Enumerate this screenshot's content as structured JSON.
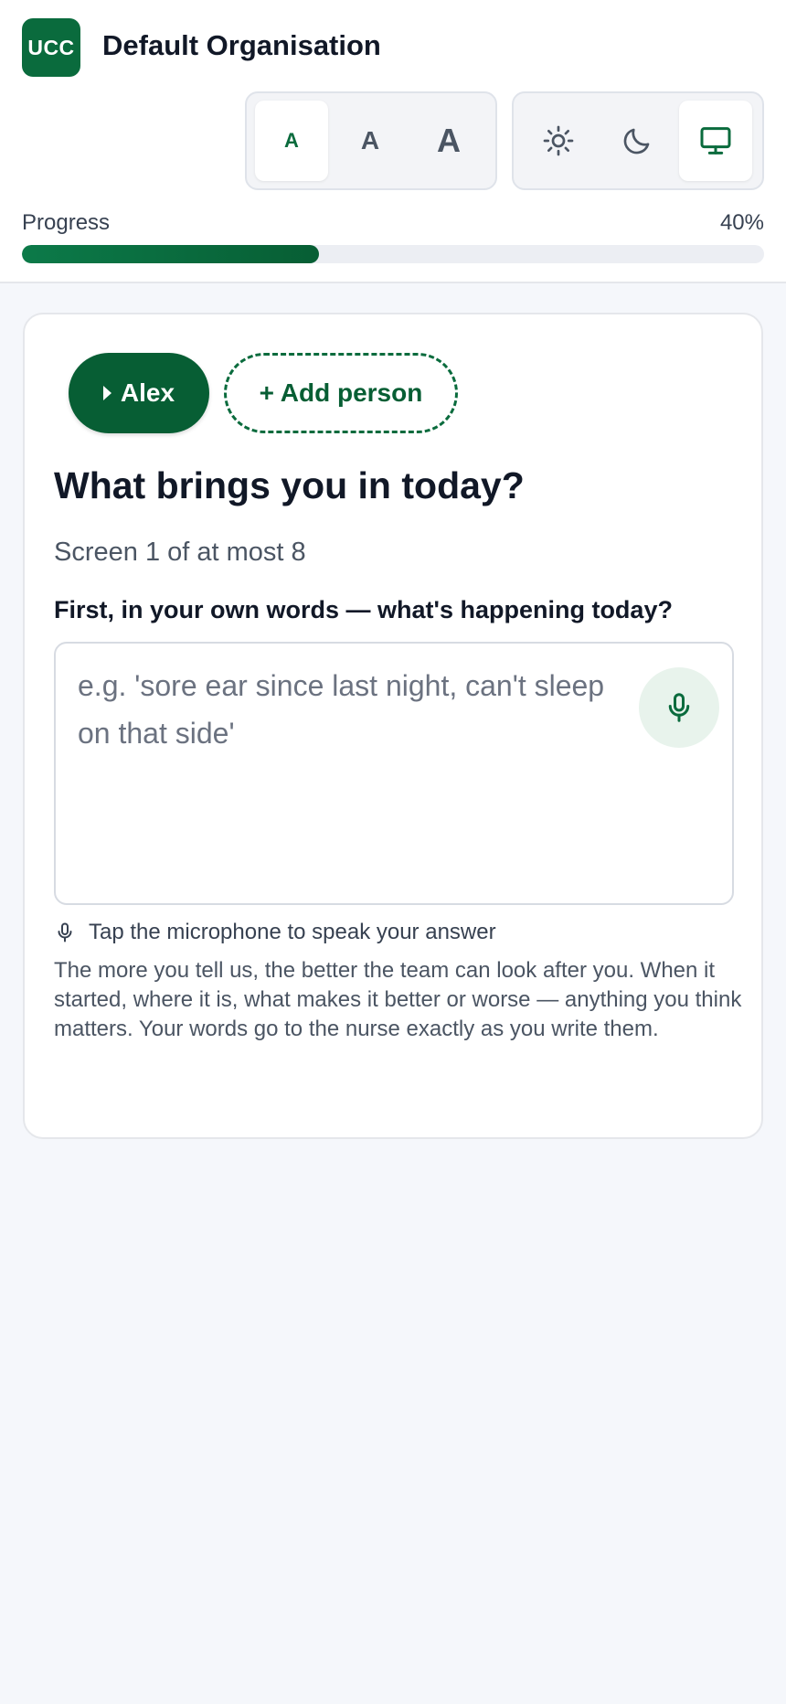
{
  "header": {
    "logo_text": "UCC",
    "org_name": "Default Organisation",
    "font_size_options": [
      "A",
      "A",
      "A"
    ],
    "font_size_selected_index": 0,
    "theme_options": [
      "light-theme-icon",
      "dark-theme-icon",
      "system-theme-icon"
    ],
    "theme_selected": "system"
  },
  "progress": {
    "label": "Progress",
    "percent_text": "40%",
    "value": 0.4
  },
  "card": {
    "person_name": "Alex",
    "add_person_label": "+ Add person",
    "title": "What brings you in today?",
    "screen_count": "Screen 1 of at most 8",
    "field_label": "First, in your own words — what's happening today?",
    "field_placeholder": "e.g. 'sore ear since last night, can't sleep on that side'",
    "field_value": "",
    "mic_hint": "Tap the microphone to speak your answer",
    "help_text": "The more you tell us, the better the team can look after you. When it started, where it is, what makes it better or worse — anything you think matters. Your words go to the nurse exactly as you write them."
  },
  "colors": {
    "brand": "#0a6b3d",
    "brand_dark": "#075e34",
    "mic_bg": "#e8f3ec"
  }
}
